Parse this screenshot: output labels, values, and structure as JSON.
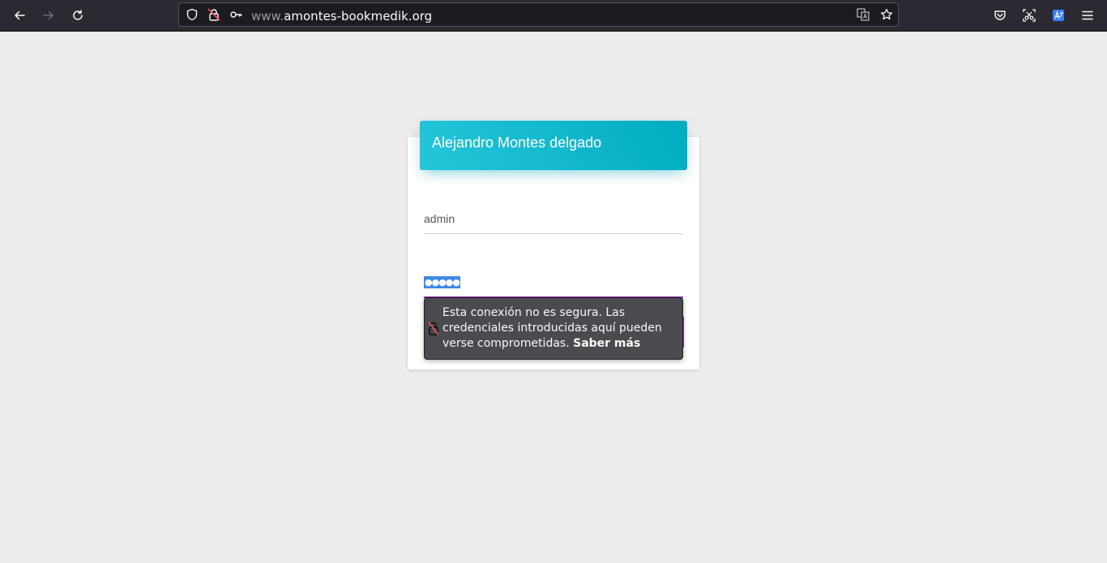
{
  "browser": {
    "url_prefix": "www.",
    "url_domain": "amontes-bookmedik.org",
    "icons": {
      "back": "back-arrow-icon",
      "forward": "forward-arrow-icon",
      "reload": "reload-icon",
      "tracking": "shield-icon",
      "insecure": "insecure-lock-icon",
      "key": "key-icon",
      "translate": "translate-icon",
      "bookmark": "star-icon",
      "pocket": "pocket-icon",
      "screenshot": "screenshot-icon",
      "extension": "translate-extension-icon",
      "menu": "hamburger-menu-icon"
    }
  },
  "login": {
    "title": "Alejandro Montes delgado",
    "username_value": "admin",
    "password_masked": "●●●●●"
  },
  "insecure_popup": {
    "message": "Esta conexión no es segura. Las credenciales introducidas aquí pueden verse comprometidas.",
    "link": "Saber más"
  },
  "colors": {
    "header_gradient_start": "#26c6da",
    "header_gradient_end": "#00acc1",
    "focus_underline": "#9c27b0",
    "toolbar": "#2b2a33"
  }
}
